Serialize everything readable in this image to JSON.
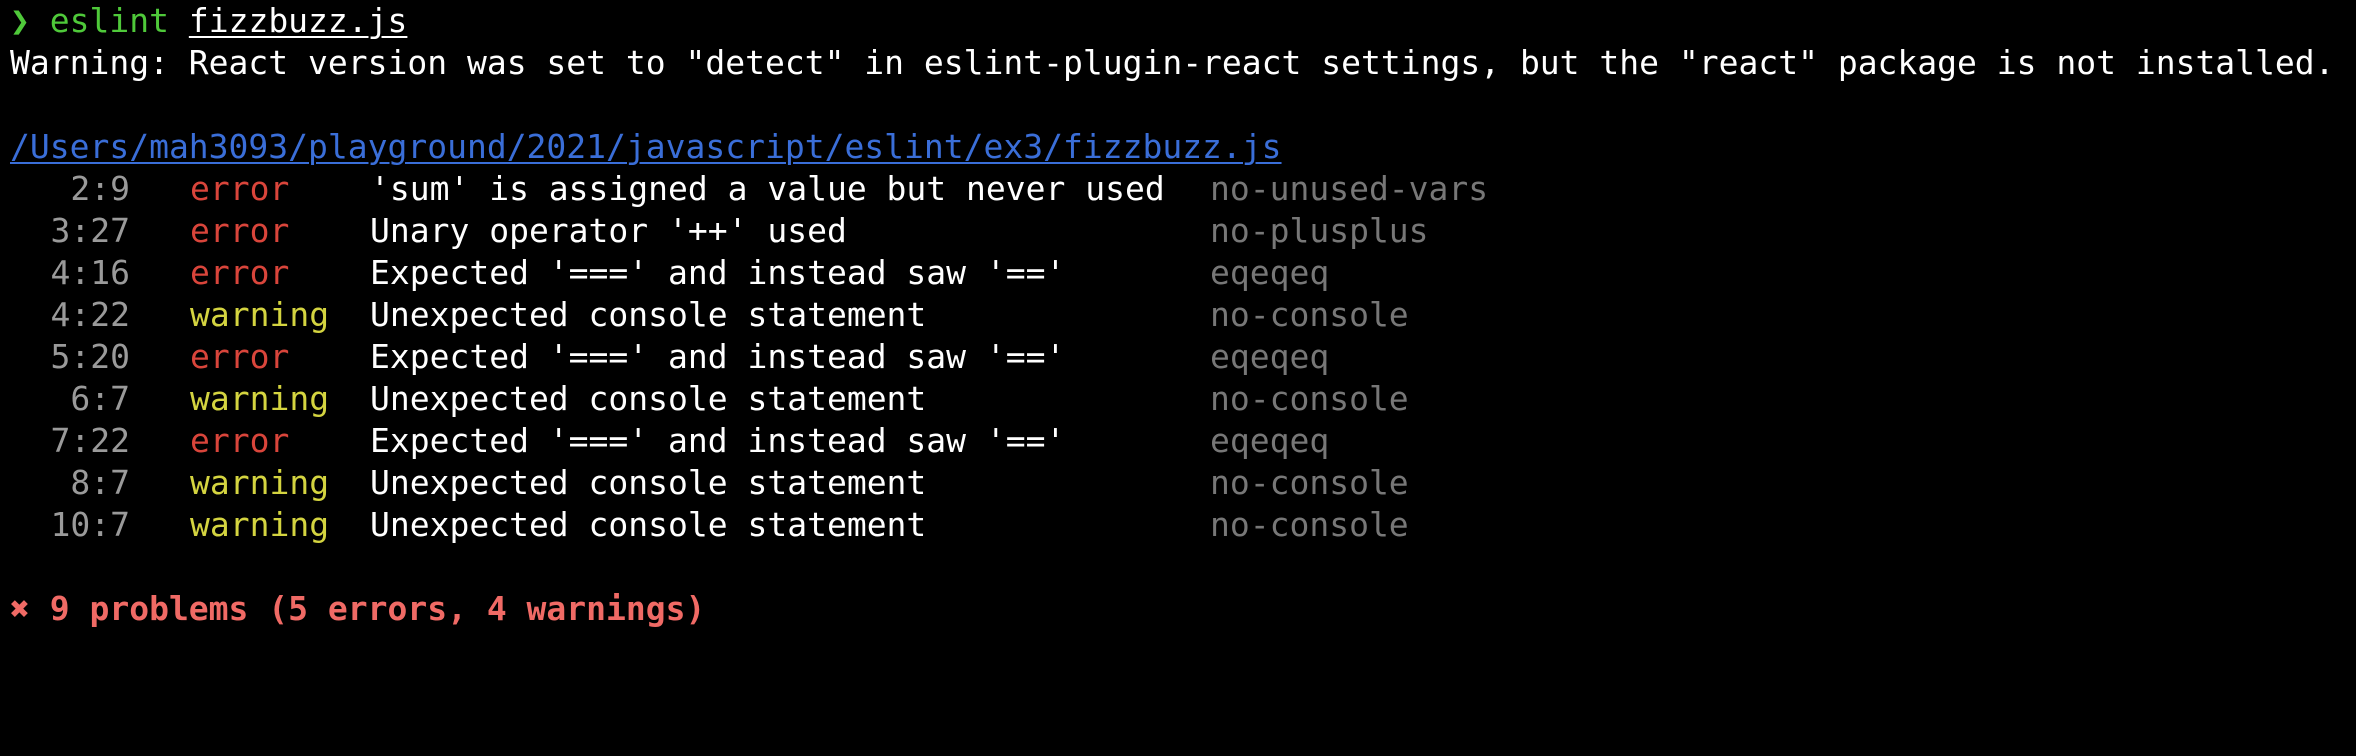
{
  "prompt": {
    "symbol": "❯",
    "command": "eslint",
    "argument": "fizzbuzz.js"
  },
  "warning_message": "Warning: React version was set to \"detect\" in eslint-plugin-react settings, but the \"react\" package is not installed.",
  "file_path": "/Users/mah3093/playground/2021/javascript/eslint/ex3/fizzbuzz.js",
  "problems": [
    {
      "location": "2:9",
      "severity": "error",
      "message": "'sum' is assigned a value but never used",
      "rule": "no-unused-vars"
    },
    {
      "location": "3:27",
      "severity": "error",
      "message": "Unary operator '++' used",
      "rule": "no-plusplus"
    },
    {
      "location": "4:16",
      "severity": "error",
      "message": "Expected '===' and instead saw '=='",
      "rule": "eqeqeq"
    },
    {
      "location": "4:22",
      "severity": "warning",
      "message": "Unexpected console statement",
      "rule": "no-console"
    },
    {
      "location": "5:20",
      "severity": "error",
      "message": "Expected '===' and instead saw '=='",
      "rule": "eqeqeq"
    },
    {
      "location": "6:7",
      "severity": "warning",
      "message": "Unexpected console statement",
      "rule": "no-console"
    },
    {
      "location": "7:22",
      "severity": "error",
      "message": "Expected '===' and instead saw '=='",
      "rule": "eqeqeq"
    },
    {
      "location": "8:7",
      "severity": "warning",
      "message": "Unexpected console statement",
      "rule": "no-console"
    },
    {
      "location": "10:7",
      "severity": "warning",
      "message": "Unexpected console statement",
      "rule": "no-console"
    }
  ],
  "summary": "✖ 9 problems (5 errors, 4 warnings)",
  "colors": {
    "background": "#000000",
    "prompt_green": "#4fc93a",
    "error_red": "#d9453b",
    "warning_yellow": "#d4d440",
    "path_blue": "#3a6ed8",
    "rule_gray": "#777777",
    "summary_red": "#f06a65"
  }
}
